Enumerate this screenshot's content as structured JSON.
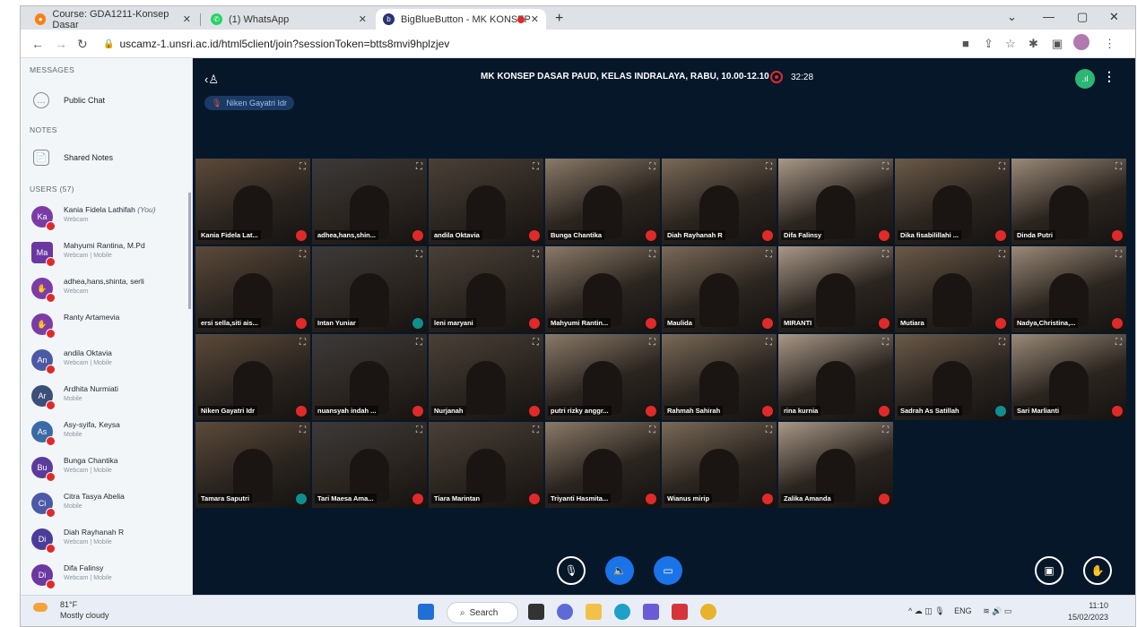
{
  "browser": {
    "tabs": [
      {
        "title": "Course: GDA1211-Konsep Dasar",
        "favicon": "moodle-icon"
      },
      {
        "title": "(1) WhatsApp",
        "favicon": "whatsapp-icon"
      },
      {
        "title": "BigBlueButton - MK KONSEP",
        "favicon": "bbb-icon"
      }
    ],
    "url": "uscamz-1.unsri.ac.id/html5client/join?sessionToken=btts8mvi9hplzjev"
  },
  "sidebar": {
    "messages_heading": "MESSAGES",
    "public_chat": "Public Chat",
    "notes_heading": "NOTES",
    "shared_notes": "Shared Notes",
    "users_heading": "USERS (57)",
    "users": [
      {
        "initials": "Ka",
        "name": "Kania Fidela Lathifah",
        "you": "(You)",
        "status": "Webcam",
        "color": "#7b3ca8"
      },
      {
        "initials": "Ma",
        "name": "Mahyumi Rantina, M.Pd",
        "status": "Webcam | Mobile",
        "color": "#6b37a1",
        "square": true
      },
      {
        "initials": "",
        "name": "adhea,hans,shinta, serli",
        "status": "Webcam",
        "color": "#7b3ca8"
      },
      {
        "initials": "",
        "name": "Ranty Artamevia",
        "status": "",
        "color": "#7b3ca8"
      },
      {
        "initials": "An",
        "name": "andila Oktavia",
        "status": "Webcam | Mobile",
        "color": "#4b5aa6"
      },
      {
        "initials": "Ar",
        "name": "Ardhita Nurmiati",
        "status": "Mobile",
        "color": "#3c4f7a"
      },
      {
        "initials": "As",
        "name": "Asy-syifa, Keysa",
        "status": "Mobile",
        "color": "#3c6aa6"
      },
      {
        "initials": "Bu",
        "name": "Bunga Chantika",
        "status": "Webcam | Mobile",
        "color": "#5b3c9a"
      },
      {
        "initials": "Ci",
        "name": "Citra Tasya Abelia",
        "status": "Mobile",
        "color": "#4b5aa6"
      },
      {
        "initials": "Di",
        "name": "Diah Rayhanah R",
        "status": "Webcam | Mobile",
        "color": "#4b3c9a"
      },
      {
        "initials": "Di",
        "name": "Difa Falinsy",
        "status": "Webcam | Mobile",
        "color": "#6b37a1"
      }
    ]
  },
  "meeting": {
    "title": "MK KONSEP DASAR PAUD, KELAS INDRALAYA, RABU, 10.00-12.10",
    "timer": "32:28",
    "talker": "Niken Gayatri Idr"
  },
  "tiles": [
    {
      "name": "Kania Fidela Lat...",
      "muted": true
    },
    {
      "name": "adhea,hans,shin...",
      "muted": true
    },
    {
      "name": "andila Oktavia",
      "muted": true
    },
    {
      "name": "Bunga Chantika",
      "muted": true
    },
    {
      "name": "Diah Rayhanah R",
      "muted": true
    },
    {
      "name": "Difa Falinsy",
      "muted": true
    },
    {
      "name": "Dika fisabilillahi ...",
      "muted": true
    },
    {
      "name": "Dinda Putri",
      "muted": true
    },
    {
      "name": "ersi sella,siti ais...",
      "muted": true
    },
    {
      "name": "Intan Yuniar",
      "muted": false
    },
    {
      "name": "leni maryani",
      "muted": true
    },
    {
      "name": "Mahyumi Rantin...",
      "muted": true
    },
    {
      "name": "Maulida",
      "muted": true
    },
    {
      "name": "MIRANTI",
      "muted": true
    },
    {
      "name": "Mutiara",
      "muted": true
    },
    {
      "name": "Nadya,Christina,...",
      "muted": true
    },
    {
      "name": "Niken Gayatri Idr",
      "muted": true
    },
    {
      "name": "nuansyah indah ...",
      "muted": true
    },
    {
      "name": "Nurjanah",
      "muted": true
    },
    {
      "name": "putri rizky anggr...",
      "muted": true
    },
    {
      "name": "Rahmah Sahirah",
      "muted": true
    },
    {
      "name": "rina kurnia",
      "muted": true
    },
    {
      "name": "Sadrah As Satillah",
      "muted": false
    },
    {
      "name": "Sari Marlianti",
      "muted": true
    },
    {
      "name": "Tamara Saputri",
      "muted": false
    },
    {
      "name": "Tari Maesa Ama...",
      "muted": true
    },
    {
      "name": "Tiara Marintan",
      "muted": true
    },
    {
      "name": "Triyanti Hasmita...",
      "muted": true
    },
    {
      "name": "Wianus mirip",
      "muted": true
    },
    {
      "name": "Zalika Amanda",
      "muted": true
    }
  ],
  "taskbar": {
    "temp": "81°F",
    "weather": "Mostly cloudy",
    "search": "Search",
    "lang": "ENG",
    "time": "11:10",
    "date": "15/02/2023"
  }
}
